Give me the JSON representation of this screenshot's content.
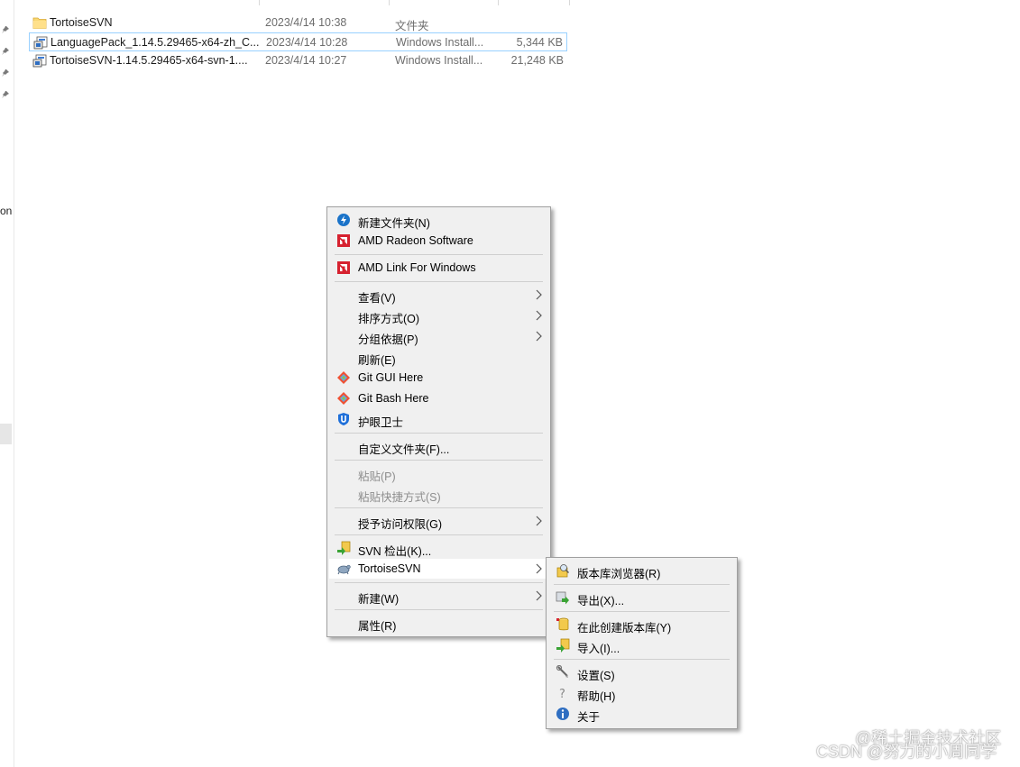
{
  "nav": {
    "partial_label": "on"
  },
  "files": [
    {
      "name": "TortoiseSVN",
      "date": "2023/4/14 10:38",
      "type": "文件夹",
      "size": "",
      "icon": "folder-icon"
    },
    {
      "name": "LanguagePack_1.14.5.29465-x64-zh_C...",
      "date": "2023/4/14 10:28",
      "type": "Windows Install...",
      "size": "5,344 KB",
      "icon": "msi-installer-icon"
    },
    {
      "name": "TortoiseSVN-1.14.5.29465-x64-svn-1....",
      "date": "2023/4/14 10:27",
      "type": "Windows Install...",
      "size": "21,248 KB",
      "icon": "msi-installer-icon"
    }
  ],
  "context_menu": {
    "items": [
      {
        "label": "新建文件夹(N)",
        "icon": "new-folder-icon"
      },
      {
        "label": "AMD Radeon Software",
        "icon": "amd-icon"
      },
      {
        "label": "AMD Link For Windows",
        "icon": "amd-icon"
      },
      {
        "label": "查看(V)",
        "submenu": true
      },
      {
        "label": "排序方式(O)",
        "submenu": true
      },
      {
        "label": "分组依据(P)",
        "submenu": true
      },
      {
        "label": "刷新(E)"
      },
      {
        "label": "Git GUI Here",
        "icon": "git-icon"
      },
      {
        "label": "Git Bash Here",
        "icon": "git-icon"
      },
      {
        "label": "护眼卫士",
        "icon": "shield-icon"
      },
      {
        "label": "自定义文件夹(F)..."
      },
      {
        "label": "粘贴(P)",
        "disabled": true
      },
      {
        "label": "粘贴快捷方式(S)",
        "disabled": true
      },
      {
        "label": "授予访问权限(G)",
        "submenu": true
      },
      {
        "label": "SVN 检出(K)...",
        "icon": "svn-checkout-icon"
      },
      {
        "label": "TortoiseSVN",
        "icon": "tortoise-icon",
        "submenu": true,
        "highlighted": true
      },
      {
        "label": "新建(W)",
        "submenu": true
      },
      {
        "label": "属性(R)"
      }
    ]
  },
  "submenu": {
    "items": [
      {
        "label": "版本库浏览器(R)",
        "icon": "repo-browser-icon"
      },
      {
        "label": "导出(X)...",
        "icon": "export-icon"
      },
      {
        "label": "在此创建版本库(Y)",
        "icon": "create-repo-icon"
      },
      {
        "label": "导入(I)...",
        "icon": "import-icon"
      },
      {
        "label": "设置(S)",
        "icon": "settings-icon"
      },
      {
        "label": "帮助(H)",
        "icon": "help-icon"
      },
      {
        "label": "关于",
        "icon": "about-icon"
      }
    ]
  },
  "watermark": {
    "line1": "@稀土掘金技术社区",
    "line2": "CSDN @努力的小周同学"
  },
  "colors": {
    "menu_bg": "#f0f0f0",
    "selection_border": "#99d1ff",
    "amd_red": "#d6212f",
    "disabled_text": "#8d8d8d"
  }
}
